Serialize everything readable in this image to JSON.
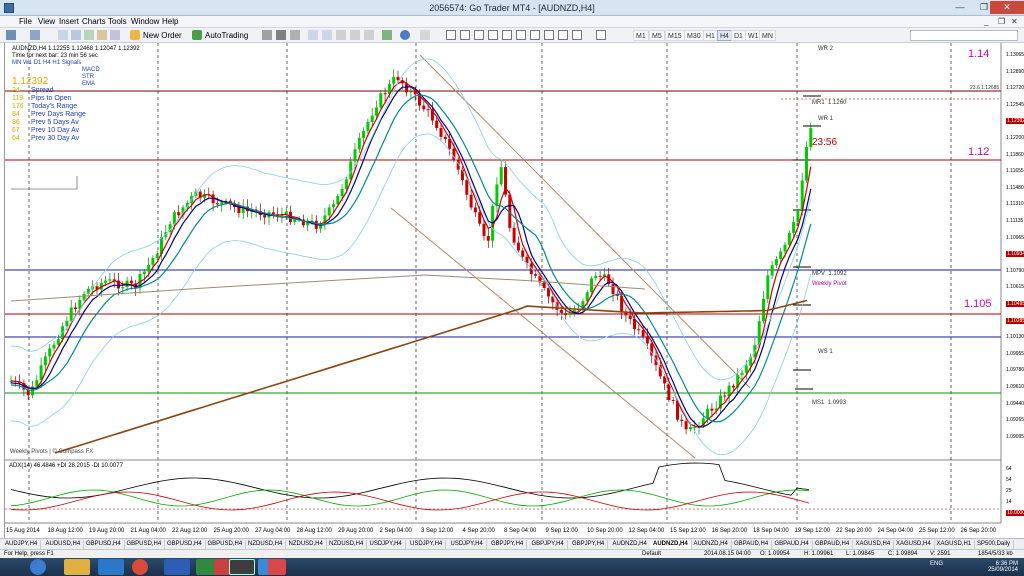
{
  "window": {
    "title": "2056574: Go Trader MT4 - [AUDNZD,H4]",
    "minimize": "—",
    "maximize": "❐",
    "close": "✕"
  },
  "menu": {
    "items": [
      "File",
      "View",
      "Insert",
      "Charts",
      "Tools",
      "Window",
      "Help"
    ],
    "mdi": {
      "minimize": "_",
      "restore": "❐",
      "close": "✕"
    }
  },
  "toolbar": {
    "new_order": "New Order",
    "autotrading": "AutoTrading",
    "timeframes": [
      "M1",
      "M5",
      "M15",
      "M30",
      "H1",
      "H4",
      "D1",
      "W1",
      "MN"
    ],
    "active_timeframe": "H4"
  },
  "chart": {
    "symbol_line": "AUDNZD,H4  1.12255 1.12468 1.12047 1.12392",
    "bar_timer": "Time for next bar: 23 min 56 sec",
    "indicator_grid": {
      "timeframes": [
        "MN",
        "W1",
        "D1",
        "H4",
        "H1"
      ],
      "signals": [
        "MACD",
        "STR",
        "EMA"
      ],
      "signals_header": "Signals"
    },
    "dashboard": {
      "price": "1.12392",
      "rows": [
        {
          "value": "24",
          "label": "Spread"
        },
        {
          "value": "119",
          "label": "Pips to Open"
        },
        {
          "value": "176",
          "label": "Today's Range"
        },
        {
          "value": "84",
          "label": "Prev Days Range"
        },
        {
          "value": "86",
          "label": "Prev 5 Days Av"
        },
        {
          "value": "67",
          "label": "Prev 10 Day Av"
        },
        {
          "value": "64",
          "label": "Prev 30 Day Av"
        }
      ]
    },
    "countdown": "23:56",
    "watermark": "Weekly Pivots | © Compass FX",
    "annotations": [
      "1.14",
      "1.12",
      "1.105"
    ],
    "pivots": [
      {
        "label": "WR 2"
      },
      {
        "label": "MR1",
        "value": "1.1260"
      },
      {
        "label": "WR 1"
      },
      {
        "label": "MPV",
        "value": "1.1092"
      },
      {
        "label": "Weekly Pivot"
      },
      {
        "label": "WS 1"
      },
      {
        "label": "MS1",
        "value": "1.0993"
      }
    ],
    "price_axis": [
      "1.13065",
      "1.12890",
      "1.12720",
      "1.12545",
      "1.12392",
      "1.12200",
      "1.11860",
      "1.11655",
      "1.11480",
      "1.11310",
      "1.11135",
      "1.10965",
      "1.10934",
      "1.10790",
      "1.10615",
      "1.10495",
      "1.10285",
      "1.10130",
      "1.09955",
      "1.09780",
      "1.09610",
      "1.09440",
      "1.09265",
      "1.09095"
    ],
    "price_axis_boxed": [
      "1.12392",
      "1.12000",
      "1.10934",
      "1.10495",
      "1.10285",
      "1.09930"
    ],
    "r1_price": "23.6  1.12685",
    "time_axis": [
      "15 Aug 2014",
      "18 Aug 12:00",
      "19 Aug 20:00",
      "21 Aug 04:00",
      "22 Aug 12:00",
      "25 Aug 20:00",
      "27 Aug 04:00",
      "28 Aug 12:00",
      "29 Aug 20:00",
      "2 Sep 04:00",
      "3 Sep 12:00",
      "4 Sep 20:00",
      "8 Sep 04:00",
      "9 Sep 12:00",
      "10 Sep 20:00",
      "12 Sep 04:00",
      "15 Sep 12:00",
      "16 Sep 20:00",
      "18 Sep 04:00",
      "19 Sep 12:00",
      "22 Sep 20:00",
      "24 Sep 04:00",
      "25 Sep 12:00",
      "26 Sep 20:00"
    ],
    "adx": {
      "label": "ADX(14) 46.4846 +DI 28.2015 -DI 10.0077",
      "axis": [
        "64",
        "54",
        "25",
        "14",
        "10.0000"
      ]
    },
    "colors": {
      "bull": "#00cc00",
      "bear": "#cc0000",
      "ma_fast": "#cc0000",
      "ma_mid": "#000080",
      "ma_slow": "#008b8b",
      "ma_long": "#8b4513",
      "band": "#87ceeb",
      "level": "#b00000"
    }
  },
  "tabs": [
    "AUDJPY,H4",
    "AUDUSD,H4",
    "GBPUSD,H4",
    "GBPUSD,H4",
    "GBPUSD,H4",
    "GBPUSD,H4",
    "NZDUSD,H4",
    "NZDUSD,H4",
    "NZDUSD,H4",
    "USDJPY,H4",
    "USDJPY,H4",
    "USDJPY,H4",
    "GBPJPY,H4",
    "GBPJPY,H4",
    "GBPJPY,H4",
    "AUDNZD,H4",
    "AUDNZD,H4",
    "AUDNZD,H4",
    "GBPAUD,H4",
    "GBPAUD,H4",
    "GBPAUD,H4",
    "XAGUSD,H4",
    "XAGUSD,H4",
    "XAGUSD,H1",
    "SP500,Daily"
  ],
  "active_tab": "AUDNZD,H4",
  "status": {
    "help": "For Help, press F1",
    "profile": "Default",
    "datetime": "2014.08.15 04:00",
    "open": "O: 1.09954",
    "high": "H: 1.09961",
    "low": "L: 1.09845",
    "close": "C: 1.09894",
    "volume": "V: 2591",
    "traffic": "1854/5/33 kb"
  },
  "taskbar": {
    "apps": [
      "windows-icon",
      "explorer-icon",
      "media-icon",
      "chrome-icon",
      "word-icon",
      "excel-icon",
      "chart-icon",
      "mt4-icon",
      "dropbox-icon",
      "trading-icon"
    ],
    "lang": "ENG",
    "time": "6:36 PM",
    "date": "25/09/2014"
  }
}
